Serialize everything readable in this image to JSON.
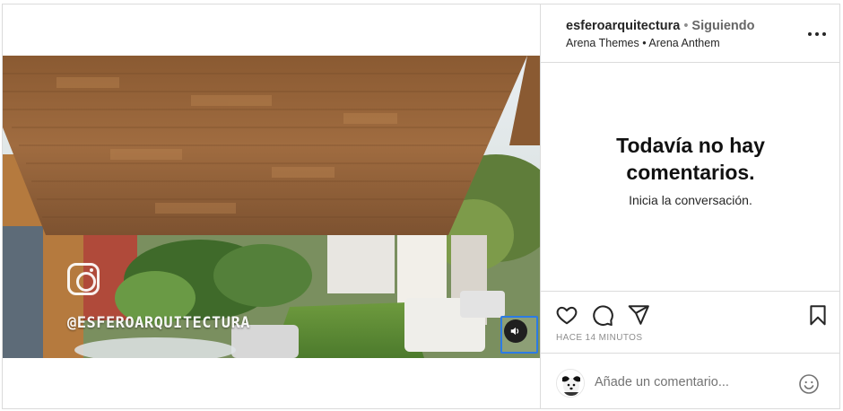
{
  "post": {
    "username": "esferoarquitectura",
    "separator": "•",
    "follow_status": "Siguiendo",
    "audio_line": "Arena Themes • Arena Anthem",
    "watermark_text": "@ESFEROARQUITECTURA"
  },
  "comments": {
    "empty_title": "Todavía no hay comentarios.",
    "empty_subtitle": "Inicia la conversación."
  },
  "actions": {
    "timestamp": "HACE 14 MINUTOS"
  },
  "composer": {
    "placeholder": "Añade un comentario..."
  },
  "icons": [
    "more-options-icon",
    "heart-icon",
    "comment-icon",
    "share-icon",
    "bookmark-icon",
    "volume-icon",
    "emoji-icon",
    "instagram-logo-icon"
  ],
  "colors": {
    "border": "#dbdbdb",
    "text": "#262626",
    "muted": "#8e8e8e",
    "focus": "#2c7be5"
  }
}
